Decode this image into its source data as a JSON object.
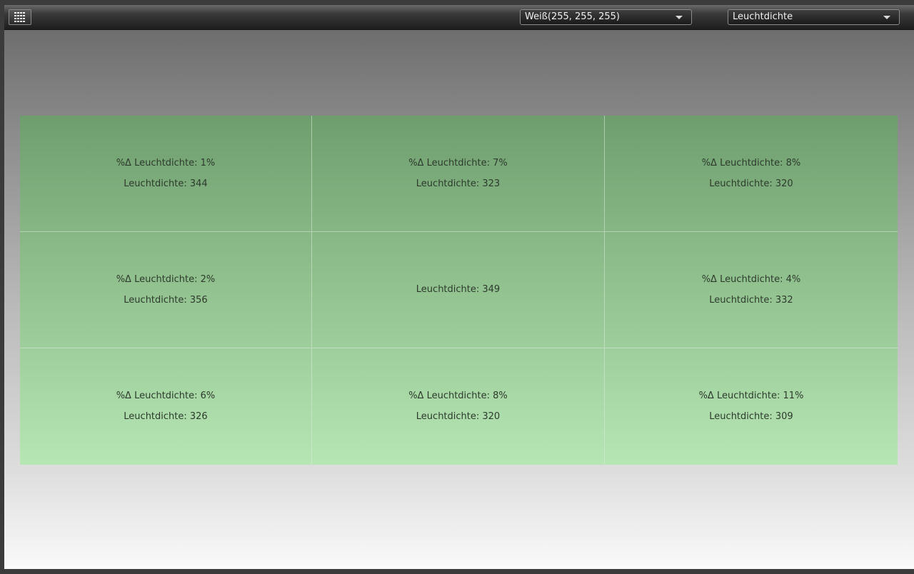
{
  "toolbar": {
    "color_dropdown": {
      "value": "Weiß(255, 255, 255)"
    },
    "mode_dropdown": {
      "value": "Leuchtdichte"
    }
  },
  "grid": {
    "cells": [
      {
        "delta": "%Δ Leuchtdichte:  1%",
        "value": "Leuchtdichte:  344"
      },
      {
        "delta": "%Δ Leuchtdichte:  7%",
        "value": "Leuchtdichte:  323"
      },
      {
        "delta": "%Δ Leuchtdichte:  8%",
        "value": "Leuchtdichte:  320"
      },
      {
        "delta": "%Δ Leuchtdichte:  2%",
        "value": "Leuchtdichte:  356"
      },
      {
        "delta": "",
        "value": "Leuchtdichte:  349"
      },
      {
        "delta": "%Δ Leuchtdichte:  4%",
        "value": "Leuchtdichte:  332"
      },
      {
        "delta": "%Δ Leuchtdichte:  6%",
        "value": "Leuchtdichte:  326"
      },
      {
        "delta": "%Δ Leuchtdichte:  8%",
        "value": "Leuchtdichte:  320"
      },
      {
        "delta": "%Δ Leuchtdichte:  11%",
        "value": "Leuchtdichte:  309"
      }
    ]
  },
  "icons": {
    "grid_button": "grid-icon",
    "dropdown_arrow": "chevron-down-icon"
  },
  "colors": {
    "panel_top": "#6e9e6e",
    "panel_bottom": "#b6e6b4"
  }
}
